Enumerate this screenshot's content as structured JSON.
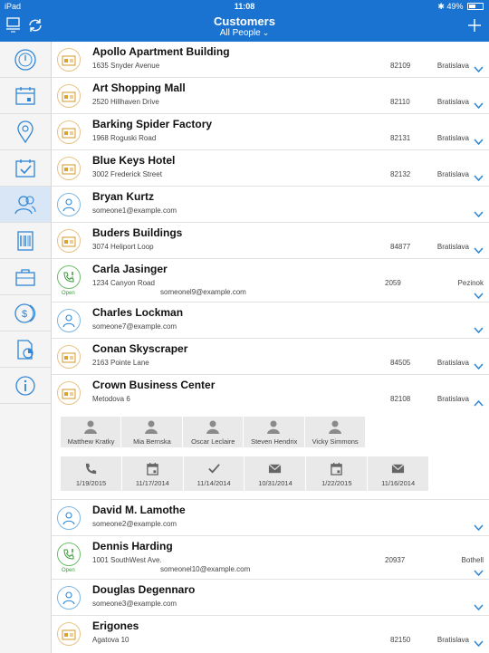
{
  "status": {
    "device": "iPad",
    "time": "11:08",
    "battery": "49%"
  },
  "nav": {
    "title": "Customers",
    "filter": "All People",
    "filter_icon": "chevron-down-icon"
  },
  "sidebar": {
    "items": [
      {
        "icon": "time-icon"
      },
      {
        "icon": "calendar-icon"
      },
      {
        "icon": "location-pin-icon"
      },
      {
        "icon": "task-check-icon"
      },
      {
        "icon": "customers-icon",
        "active": true
      },
      {
        "icon": "barcode-icon"
      },
      {
        "icon": "briefcase-icon"
      },
      {
        "icon": "money-icon"
      },
      {
        "icon": "report-chart-icon"
      },
      {
        "icon": "info-icon"
      }
    ]
  },
  "list": {
    "rows": [
      {
        "name": "Apollo Apartment Building",
        "sub": "1635 Snyder Avenue",
        "zip": "82109",
        "city": "Bratislava",
        "kind": "company"
      },
      {
        "name": "Art Shopping Mall",
        "sub": "2520 Hillhaven Drive",
        "zip": "82110",
        "city": "Bratislava",
        "kind": "company"
      },
      {
        "name": "Barking Spider Factory",
        "sub": "1968 Roguski Road",
        "zip": "82131",
        "city": "Bratislava",
        "kind": "company"
      },
      {
        "name": "Blue Keys Hotel",
        "sub": "3002 Frederick Street",
        "zip": "82132",
        "city": "Bratislava",
        "kind": "company"
      },
      {
        "name": "Bryan Kurtz",
        "sub": "someone1@example.com",
        "kind": "person"
      },
      {
        "name": "Buders Buildings",
        "sub": "3074 Heliport Loop",
        "zip": "84877",
        "city": "Bratislava",
        "kind": "company"
      },
      {
        "name": "Carla Jasinger",
        "sub": "1234 Canyon Road",
        "email": "someonel9@example.com",
        "zip": "2059",
        "city": "Pezinok",
        "kind": "call",
        "status": "Open"
      },
      {
        "name": "Charles Lockman",
        "sub": "someone7@example.com",
        "kind": "person"
      },
      {
        "name": "Conan Skyscraper",
        "sub": "2163 Pointe Lane",
        "zip": "84505",
        "city": "Bratislava",
        "kind": "company"
      },
      {
        "name": "Crown Business Center",
        "sub": "Metodova 6",
        "zip": "82108",
        "city": "Bratislava",
        "kind": "company",
        "expanded": true
      },
      {
        "name": "David M. Lamothe",
        "sub": "someone2@example.com",
        "kind": "person"
      },
      {
        "name": "Dennis Harding",
        "sub": "1001 SouthWest Ave.",
        "email": "someonel10@example.com",
        "zip": "20937",
        "city": "Bothell",
        "kind": "call",
        "status": "Open"
      },
      {
        "name": "Douglas Degennaro",
        "sub": "someone3@example.com",
        "kind": "person"
      },
      {
        "name": "Erigones",
        "sub": "Agatova 10",
        "zip": "82150",
        "city": "Bratislava",
        "kind": "company"
      }
    ]
  },
  "expanded": {
    "contacts": [
      "Matthew Kratky",
      "Mia Bernska",
      "Oscar Leclaire",
      "Steven Hendrix",
      "Vicky Simmons"
    ],
    "activities": [
      {
        "icon": "phone-icon",
        "date": "1/19/2015"
      },
      {
        "icon": "calendar-icon",
        "date": "11/17/2014"
      },
      {
        "icon": "check-icon",
        "date": "11/14/2014"
      },
      {
        "icon": "mail-icon",
        "date": "10/31/2014"
      },
      {
        "icon": "calendar-icon",
        "date": "1/22/2015"
      },
      {
        "icon": "mail-icon",
        "date": "11/16/2014"
      }
    ]
  },
  "colors": {
    "accent": "#1a73d0",
    "company_icon": "#d8a23a",
    "person_icon": "#2f86d6",
    "open_status": "#3a9a3a"
  }
}
